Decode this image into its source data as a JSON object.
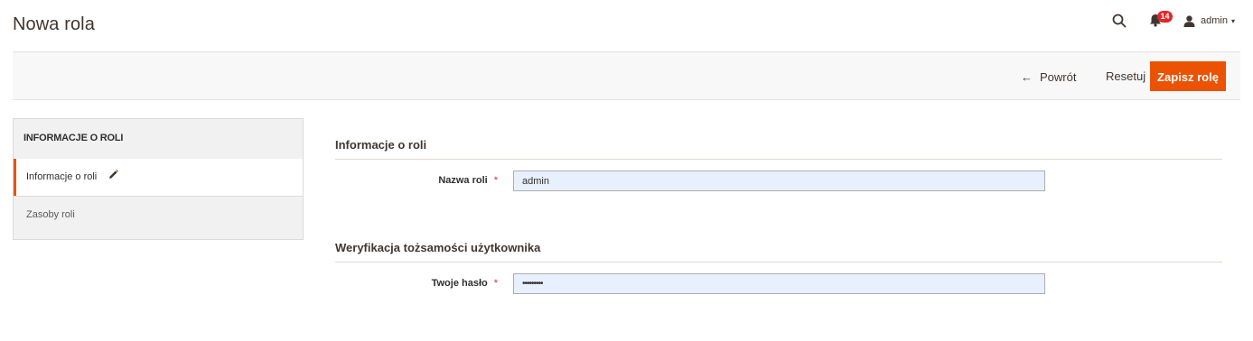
{
  "header": {
    "title": "Nowa rola",
    "notifications_count": "14",
    "user_name": "admin",
    "user_caret": "▾"
  },
  "actions": {
    "back_arrow": "←",
    "back_label": "Powrót",
    "reset_label": "Resetuj",
    "save_label": "Zapisz rolę"
  },
  "sidebar": {
    "title": "INFORMACJE O ROLI",
    "tabs": [
      {
        "label": "Informacje o roli",
        "active": true
      },
      {
        "label": "Zasoby roli",
        "active": false
      }
    ]
  },
  "sections": {
    "role_info": {
      "title": "Informacje o roli",
      "field_label": "Nazwa roli",
      "required_mark": "*",
      "field_value": "admin"
    },
    "verification": {
      "title": "Weryfikacja tożsamości użytkownika",
      "field_label": "Twoje hasło",
      "required_mark": "*",
      "field_value": "•••••••••"
    }
  },
  "colors": {
    "accent": "#eb5202",
    "badge": "#e22626",
    "input_bg": "#e8f0fe"
  }
}
